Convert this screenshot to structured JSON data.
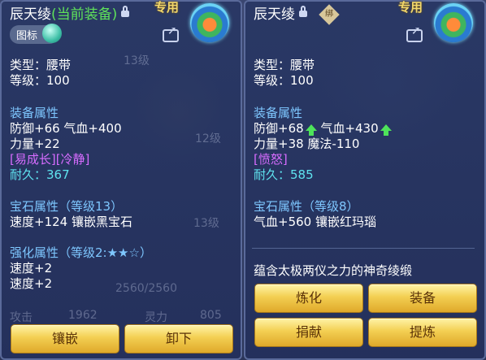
{
  "left": {
    "item_name": "辰天绫",
    "equipped_tag": "(当前装备)",
    "exclusive": "专用",
    "badge_label": "图标",
    "type_line": "类型：腰带",
    "level_line": "等级：100",
    "equip_attr_header": "装备属性",
    "stat_line1": "防御+66 气血+400",
    "stat_line2": "力量+22",
    "special_skills": "[易成长][冷静]",
    "durability": "耐久：367",
    "gem_header": "宝石属性（等级13）",
    "gem_line": "速度+124 镶嵌黑宝石",
    "enhance_header": "强化属性（等级2:★★☆）",
    "enhance_line1": "速度+2",
    "enhance_line2": "速度+2",
    "buttons": {
      "inlay": "镶嵌",
      "unequip": "卸下"
    },
    "bg_faded": {
      "hp": "2560/2560",
      "atk_label": "攻击",
      "atk_value": "1962",
      "spirit_label": "灵力",
      "spirit_value": "805",
      "lv1": "13级",
      "lv2": "12级",
      "lv3": "13级"
    }
  },
  "right": {
    "item_name": "辰天绫",
    "bound_char": "绑",
    "exclusive": "专用",
    "type_line": "类型：腰带",
    "level_line": "等级：100",
    "equip_attr_header": "装备属性",
    "stat_def": "防御+68",
    "stat_hp": "气血+430",
    "stat_line2": "力量+38 魔法-110",
    "special_skills": "[愤怒]",
    "durability": "耐久：585",
    "gem_header": "宝石属性（等级8）",
    "gem_line": "气血+560 镶嵌红玛瑙",
    "description": "蕴含太极两仪之力的神奇绫缎",
    "buttons": {
      "refine": "炼化",
      "equip": "装备",
      "donate": "捐献",
      "extract": "提炼"
    }
  },
  "colors": {
    "title_green": "#5fe35a",
    "header_blue": "#7ec7ff",
    "special_purple": "#d76cff",
    "durability_cyan": "#5fe3ef",
    "button_gold": "#f3cf52"
  }
}
